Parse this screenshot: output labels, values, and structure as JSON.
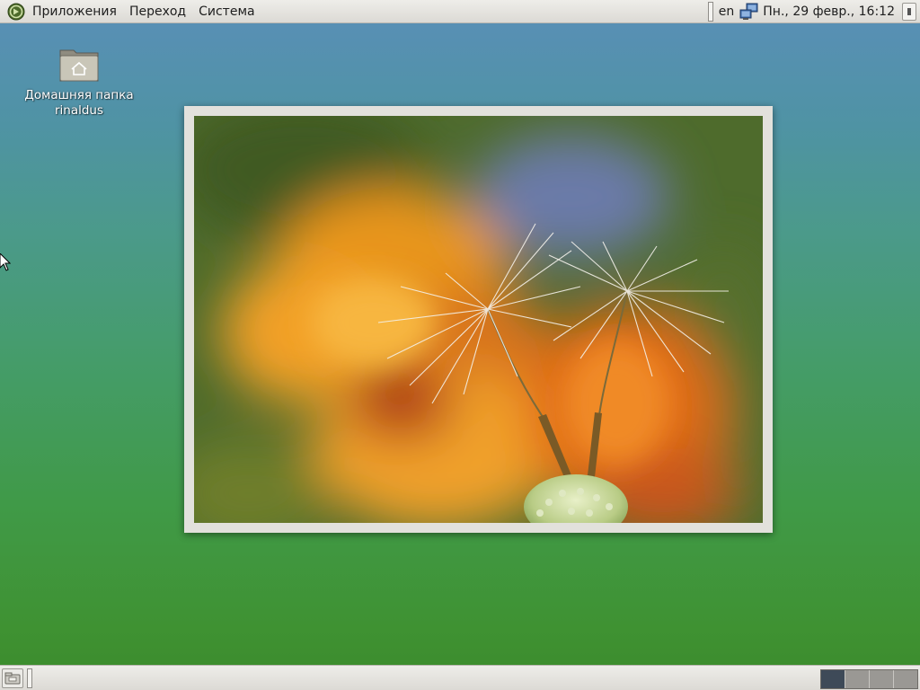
{
  "top_panel": {
    "menus": [
      "Приложения",
      "Переход",
      "Система"
    ],
    "tray": {
      "language": "en",
      "clock": "Пн., 29 февр., 16:12"
    }
  },
  "desktop": {
    "home_icon": {
      "label_line1": "Домашняя папка",
      "label_line2": "rinaldus"
    },
    "wallpaper_colors": [
      "#5a8fb8",
      "#409a48",
      "#3b8a2c"
    ]
  },
  "bottom_panel": {
    "workspaces": [
      {
        "active": true
      },
      {
        "active": false
      },
      {
        "active": false
      },
      {
        "active": false
      }
    ]
  },
  "icons": {
    "menu_logo": "mint-logo-icon",
    "network": "network-icon",
    "home_folder": "home-folder-icon",
    "show_desktop": "show-desktop-icon"
  }
}
